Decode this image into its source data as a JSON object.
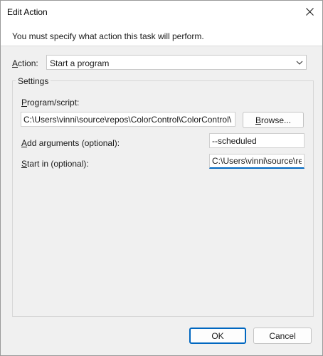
{
  "window": {
    "title": "Edit Action"
  },
  "banner": {
    "text": "You must specify what action this task will perform."
  },
  "action": {
    "label_mnemonic": "A",
    "label_rest": "ction:",
    "selected": "Start a program"
  },
  "settings": {
    "label": "Settings",
    "program": {
      "label_mnemonic": "P",
      "label_rest": "rogram/script:",
      "value": "C:\\Users\\vinni\\source\\repos\\ColorControl\\ColorControl\\",
      "browse_mnemonic": "B",
      "browse_rest": "rowse..."
    },
    "arguments": {
      "label_mnemonic": "A",
      "label_rest": "dd arguments (optional):",
      "value": "--scheduled"
    },
    "start_in": {
      "label_mnemonic": "S",
      "label_rest": "tart in (optional):",
      "value": "C:\\Users\\vinni\\source\\re"
    }
  },
  "footer": {
    "ok_label": "OK",
    "cancel_label": "Cancel"
  }
}
